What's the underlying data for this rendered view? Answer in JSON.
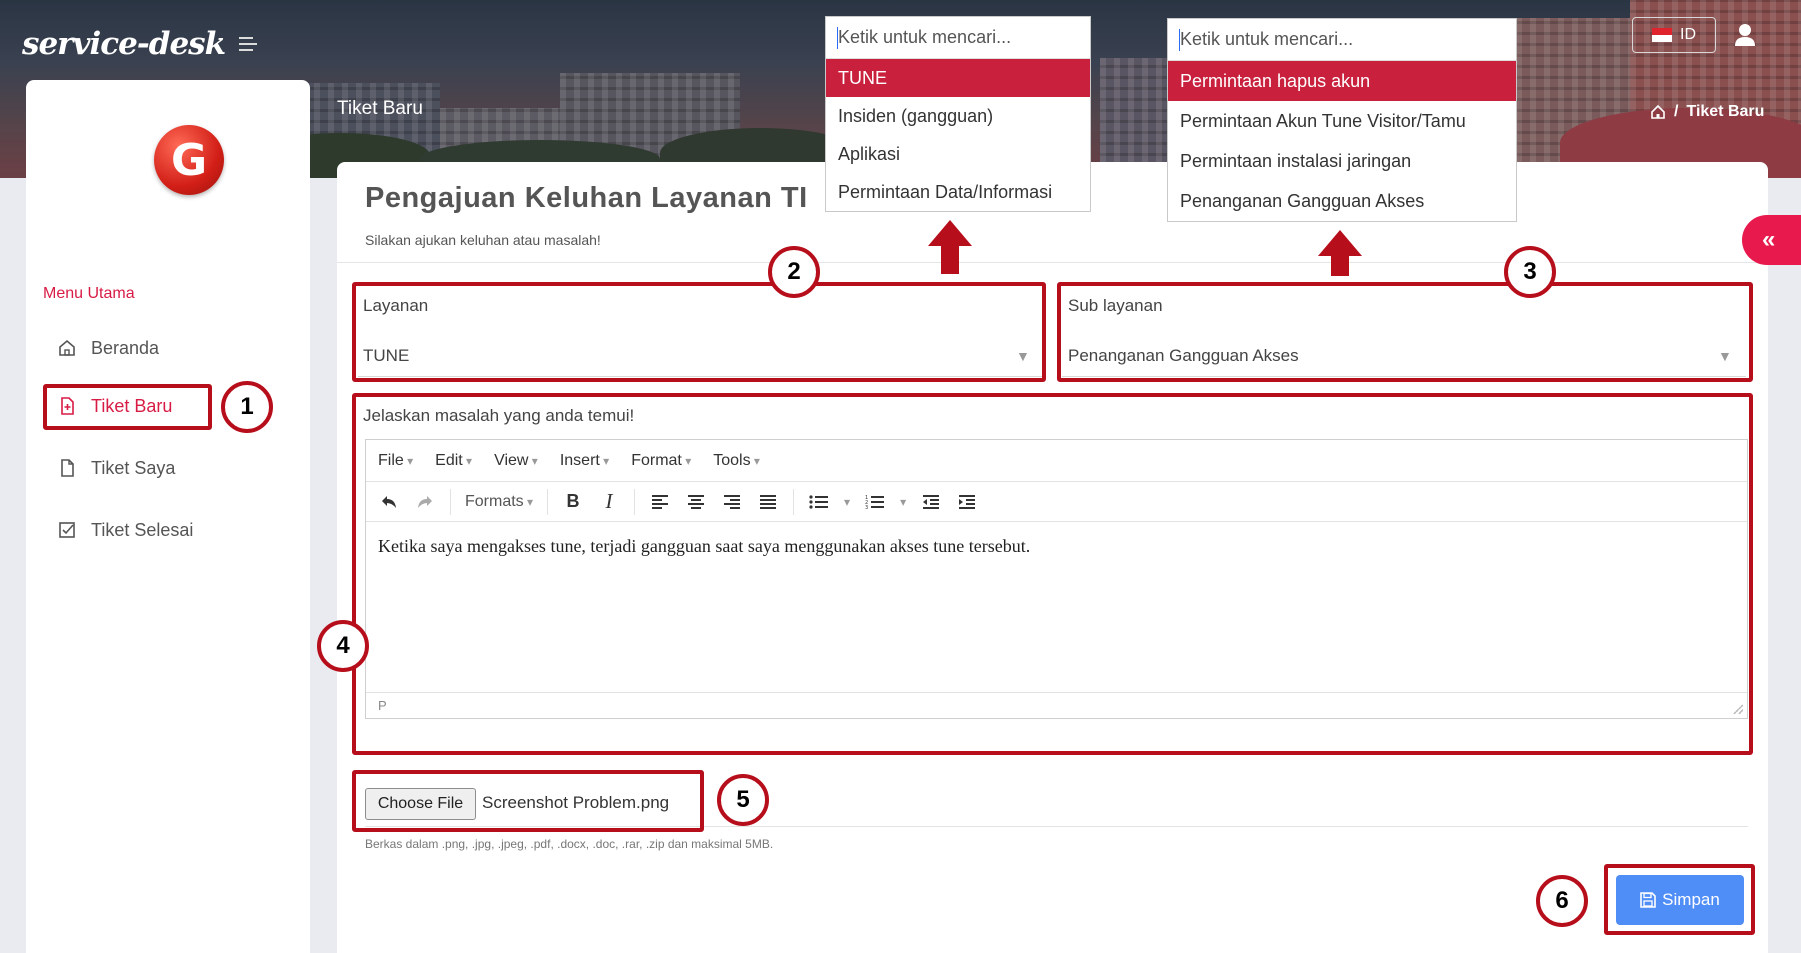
{
  "header": {
    "brand": "service-desk",
    "lang_label": "ID",
    "page_title": "Tiket Baru",
    "breadcrumb_current": "Tiket Baru",
    "breadcrumb_sep": "/"
  },
  "sidebar": {
    "menu_heading": "Menu Utama",
    "items": [
      {
        "label": "Beranda",
        "icon": "home-icon"
      },
      {
        "label": "Tiket Baru",
        "icon": "file-plus-icon",
        "active": true
      },
      {
        "label": "Tiket Saya",
        "icon": "file-icon"
      },
      {
        "label": "Tiket Selesai",
        "icon": "checklist-icon"
      }
    ]
  },
  "form": {
    "title": "Pengajuan Keluhan Layanan TI",
    "subtitle": "Silakan ajukan keluhan atau masalah!",
    "layanan": {
      "label": "Layanan",
      "value": "TUNE"
    },
    "sub_layanan": {
      "label": "Sub layanan",
      "value": "Penanganan Gangguan Akses"
    },
    "description": {
      "label": "Jelaskan masalah yang anda temui!",
      "menubar": [
        "File",
        "Edit",
        "View",
        "Insert",
        "Format",
        "Tools"
      ],
      "formats_label": "Formats",
      "content": "Ketika saya mengakses tune, terjadi gangguan saat saya menggunakan akses tune tersebut.",
      "status_path": "P"
    },
    "file": {
      "button_label": "Choose File",
      "file_name": "Screenshot Problem.png",
      "help": "Berkas dalam .png, .jpg, .jpeg, .pdf, .docx, .doc, .rar, .zip dan maksimal 5MB."
    },
    "save_label": "Simpan"
  },
  "dropdown_layanan": {
    "placeholder": "Ketik untuk mencari...",
    "options": [
      "TUNE",
      "Insiden (gangguan)",
      "Aplikasi",
      "Permintaan Data/Informasi"
    ],
    "selected_index": 0
  },
  "dropdown_sub_layanan": {
    "placeholder": "Ketik untuk mencari...",
    "options": [
      "Permintaan hapus akun",
      "Permintaan Akun Tune Visitor/Tamu",
      "Permintaan instalasi jaringan",
      "Penanganan Gangguan Akses"
    ],
    "selected_index": 0
  },
  "annotations": [
    "1",
    "2",
    "3",
    "4",
    "5",
    "6"
  ],
  "colors": {
    "accent": "#d81b45",
    "annotation": "#b70e1b",
    "save_button": "#4f8df7",
    "dropdown_selected": "#c8203d"
  }
}
